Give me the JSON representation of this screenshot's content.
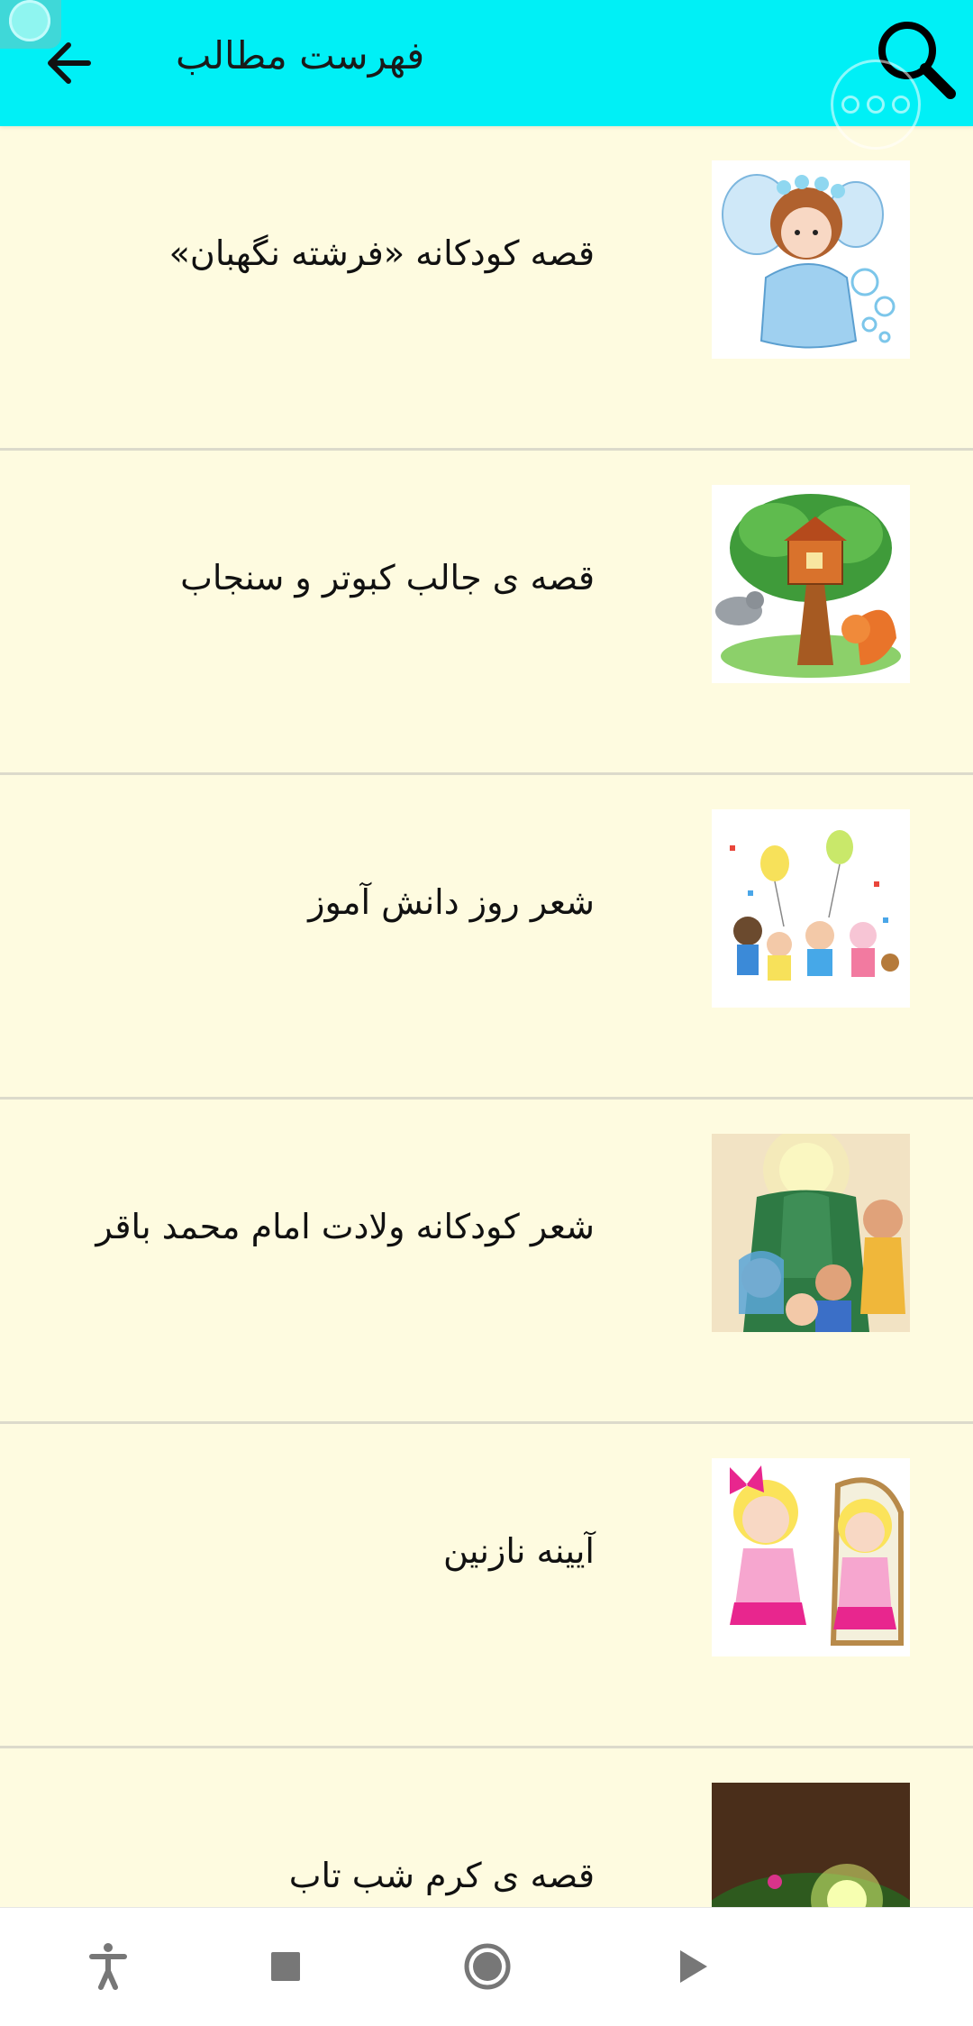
{
  "header": {
    "title": "فهرست مطالب",
    "back_icon": "arrow-left-icon",
    "search_icon": "search-icon"
  },
  "floating": {
    "overlay_icon": "floating-bubble-icon",
    "more_icon": "more-dots-icon"
  },
  "items": [
    {
      "label": "قصه کودکانه «فرشته نگهبان»",
      "thumb": "angel-doll-illustration"
    },
    {
      "label": "قصه ی جالب کبوتر و سنجاب",
      "thumb": "treehouse-pigeon-squirrel-illustration"
    },
    {
      "label": "شعر روز دانش آموز",
      "thumb": "children-balloons-illustration"
    },
    {
      "label": "شعر کودکانه ولادت امام محمد باقر",
      "thumb": "imam-children-illustration"
    },
    {
      "label": "آیینه نازنین",
      "thumb": "girl-mirror-illustration"
    },
    {
      "label": "قصه ی کرم شب تاب",
      "thumb": "glowworm-illustration"
    }
  ],
  "navbar": {
    "icons": [
      "accessibility-icon",
      "stop-icon",
      "record-icon",
      "play-icon"
    ]
  },
  "colors": {
    "header_bg": "#00F0F6",
    "list_bg": "#FEFBE0",
    "divider": "#DCDACB"
  }
}
